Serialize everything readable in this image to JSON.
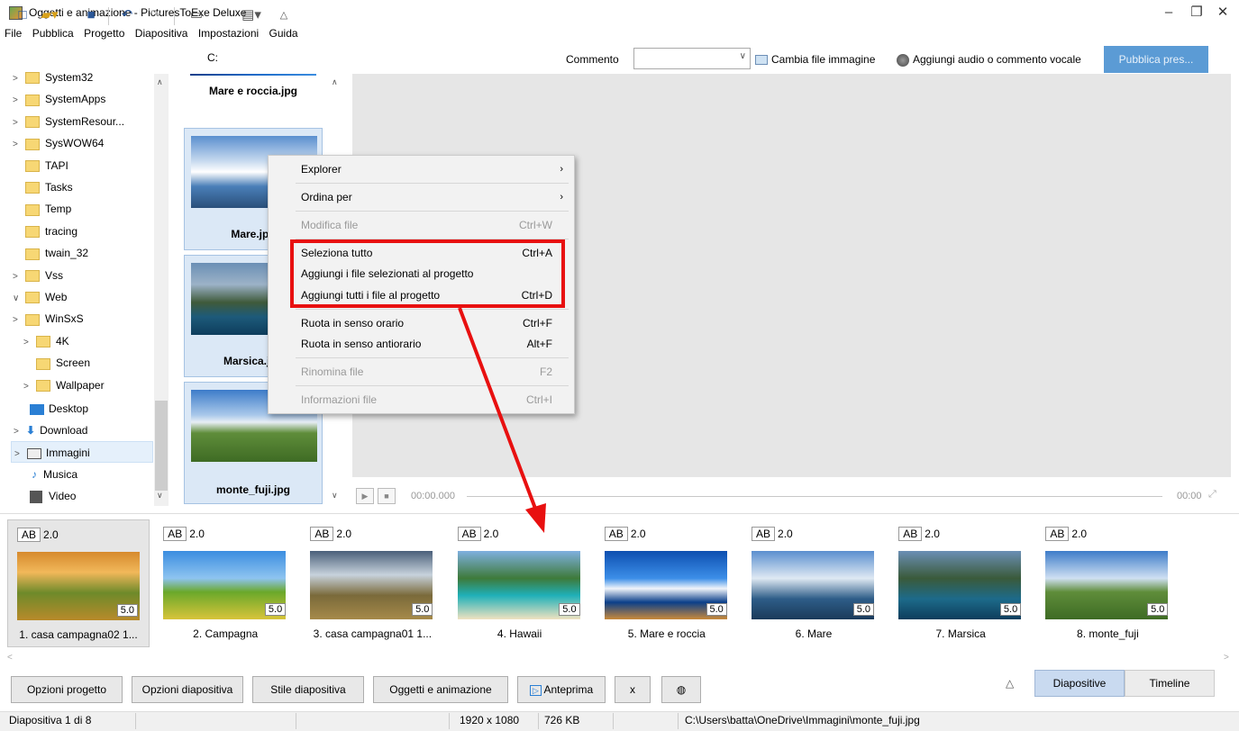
{
  "window": {
    "title": "Oggetti e animazione - PicturesToExe Deluxe",
    "minimize": "–",
    "restore": "❐",
    "close": "✕"
  },
  "menu": [
    "File",
    "Pubblica",
    "Progetto",
    "Diapositiva",
    "Impostazioni",
    "Guida"
  ],
  "toolbar": {
    "drive_label": "C:",
    "comment_label": "Commento",
    "comment_value": "",
    "change_image": "Cambia file immagine",
    "add_audio": "Aggiungi audio o commento vocale",
    "publish": "Pubblica pres..."
  },
  "tree": [
    {
      "label": "System32",
      "arrow": ">",
      "indent": 0
    },
    {
      "label": "SystemApps",
      "arrow": ">",
      "indent": 0
    },
    {
      "label": "SystemResour...",
      "arrow": ">",
      "indent": 0
    },
    {
      "label": "SysWOW64",
      "arrow": ">",
      "indent": 0
    },
    {
      "label": "TAPI",
      "arrow": "",
      "indent": 0
    },
    {
      "label": "Tasks",
      "arrow": "",
      "indent": 0
    },
    {
      "label": "Temp",
      "arrow": "",
      "indent": 0
    },
    {
      "label": "tracing",
      "arrow": "",
      "indent": 0
    },
    {
      "label": "twain_32",
      "arrow": "",
      "indent": 0
    },
    {
      "label": "Vss",
      "arrow": ">",
      "indent": 0
    },
    {
      "label": "Web",
      "arrow": "v",
      "indent": 0
    },
    {
      "label": "WinSxS",
      "arrow": ">",
      "indent": 0
    },
    {
      "label": "4K",
      "arrow": ">",
      "indent": 1
    },
    {
      "label": "Screen",
      "arrow": "",
      "indent": 1
    },
    {
      "label": "Wallpaper",
      "arrow": ">",
      "indent": 1
    }
  ],
  "tree_special": {
    "desktop": "Desktop",
    "download": "Download",
    "immagini": "Immagini",
    "musica": "Musica",
    "video": "Video"
  },
  "files": [
    {
      "name": "Mare e roccia.jpg"
    },
    {
      "name": "Mare.jpg"
    },
    {
      "name": "Marsica.jpg"
    },
    {
      "name": "monte_fuji.jpg"
    }
  ],
  "context_menu": {
    "explorer": "Explorer",
    "ordina": "Ordina per",
    "modifica": "Modifica file",
    "modifica_sc": "Ctrl+W",
    "seleziona": "Seleziona tutto",
    "seleziona_sc": "Ctrl+A",
    "aggiungi_sel": "Aggiungi i file selezionati al progetto",
    "aggiungi_tutti": "Aggiungi tutti i file al progetto",
    "aggiungi_tutti_sc": "Ctrl+D",
    "ruota_orario": "Ruota in senso orario",
    "ruota_orario_sc": "Ctrl+F",
    "ruota_anti": "Ruota in senso antiorario",
    "ruota_anti_sc": "Alt+F",
    "rinomina": "Rinomina file",
    "rinomina_sc": "F2",
    "info": "Informazioni file",
    "info_sc": "Ctrl+I"
  },
  "player": {
    "time_left": "00:00.000",
    "time_right": "00:00"
  },
  "slides": [
    {
      "ab": "AB",
      "transition": "2.0",
      "duration": "5.0",
      "label": "1. casa campagna02 1..."
    },
    {
      "ab": "AB",
      "transition": "2.0",
      "duration": "5.0",
      "label": "2. Campagna"
    },
    {
      "ab": "AB",
      "transition": "2.0",
      "duration": "5.0",
      "label": "3. casa campagna01 1..."
    },
    {
      "ab": "AB",
      "transition": "2.0",
      "duration": "5.0",
      "label": "4. Hawaii"
    },
    {
      "ab": "AB",
      "transition": "2.0",
      "duration": "5.0",
      "label": "5. Mare e roccia"
    },
    {
      "ab": "AB",
      "transition": "2.0",
      "duration": "5.0",
      "label": "6. Mare"
    },
    {
      "ab": "AB",
      "transition": "2.0",
      "duration": "5.0",
      "label": "7. Marsica"
    },
    {
      "ab": "AB",
      "transition": "2.0",
      "duration": "5.0",
      "label": "8. monte_fuji"
    }
  ],
  "bottom": {
    "opzioni_progetto": "Opzioni progetto",
    "opzioni_diapositiva": "Opzioni diapositiva",
    "stile_diapositiva": "Stile diapositiva",
    "oggetti_animazione": "Oggetti e animazione",
    "anteprima": "Anteprima",
    "x": "x",
    "tab_diapositive": "Diapositive",
    "tab_timeline": "Timeline"
  },
  "status": {
    "slide_pos": "Diapositiva 1 di 8",
    "resolution": "1920 x 1080",
    "size": "726 KB",
    "path": "C:\\Users\\batta\\OneDrive\\Immagini\\monte_fuji.jpg"
  },
  "colors": {
    "accent": "#5b9bd5",
    "highlight_box": "#e81010",
    "selected_tab": "#c9daf0"
  }
}
